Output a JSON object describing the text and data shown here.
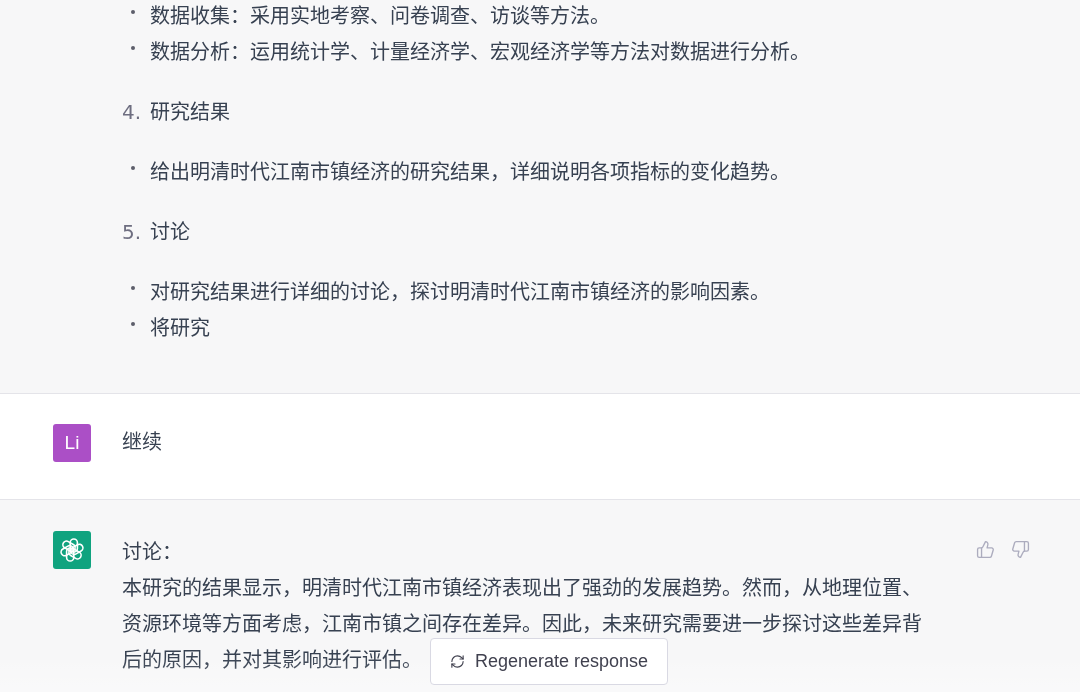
{
  "conversation": [
    {
      "kind": "assistant_continued",
      "items": [
        {
          "kind": "bullet",
          "text": "数据收集：采用实地考察、问卷调查、访谈等方法。"
        },
        {
          "kind": "bullet",
          "text": "数据分析：运用统计学、计量经济学、宏观经济学等方法对数据进行分析。"
        },
        {
          "kind": "numbered",
          "number": "4.",
          "text": "研究结果"
        },
        {
          "kind": "bullet",
          "text": "给出明清时代江南市镇经济的研究结果，详细说明各项指标的变化趋势。"
        },
        {
          "kind": "numbered",
          "number": "5.",
          "text": "讨论"
        },
        {
          "kind": "bullet",
          "text": "对研究结果进行详细的讨论，探讨明清时代江南市镇经济的影响因素。"
        },
        {
          "kind": "bullet",
          "text": "将研究"
        }
      ]
    },
    {
      "kind": "user",
      "avatar": "Li",
      "lines": [
        "继续"
      ]
    },
    {
      "kind": "assistant",
      "lines": [
        "讨论：",
        "本研究的结果显示，明清时代江南市镇经济表现出了强劲的发展趋势。然而，从地理位置、",
        "资源环境等方面考虑，江南市镇之间存在差异。因此，未来研究需要进一步探讨这些差异背",
        "后的原因，并对其影响进行评估。"
      ]
    }
  ],
  "regenerate_button": {
    "label": "Regenerate response"
  }
}
